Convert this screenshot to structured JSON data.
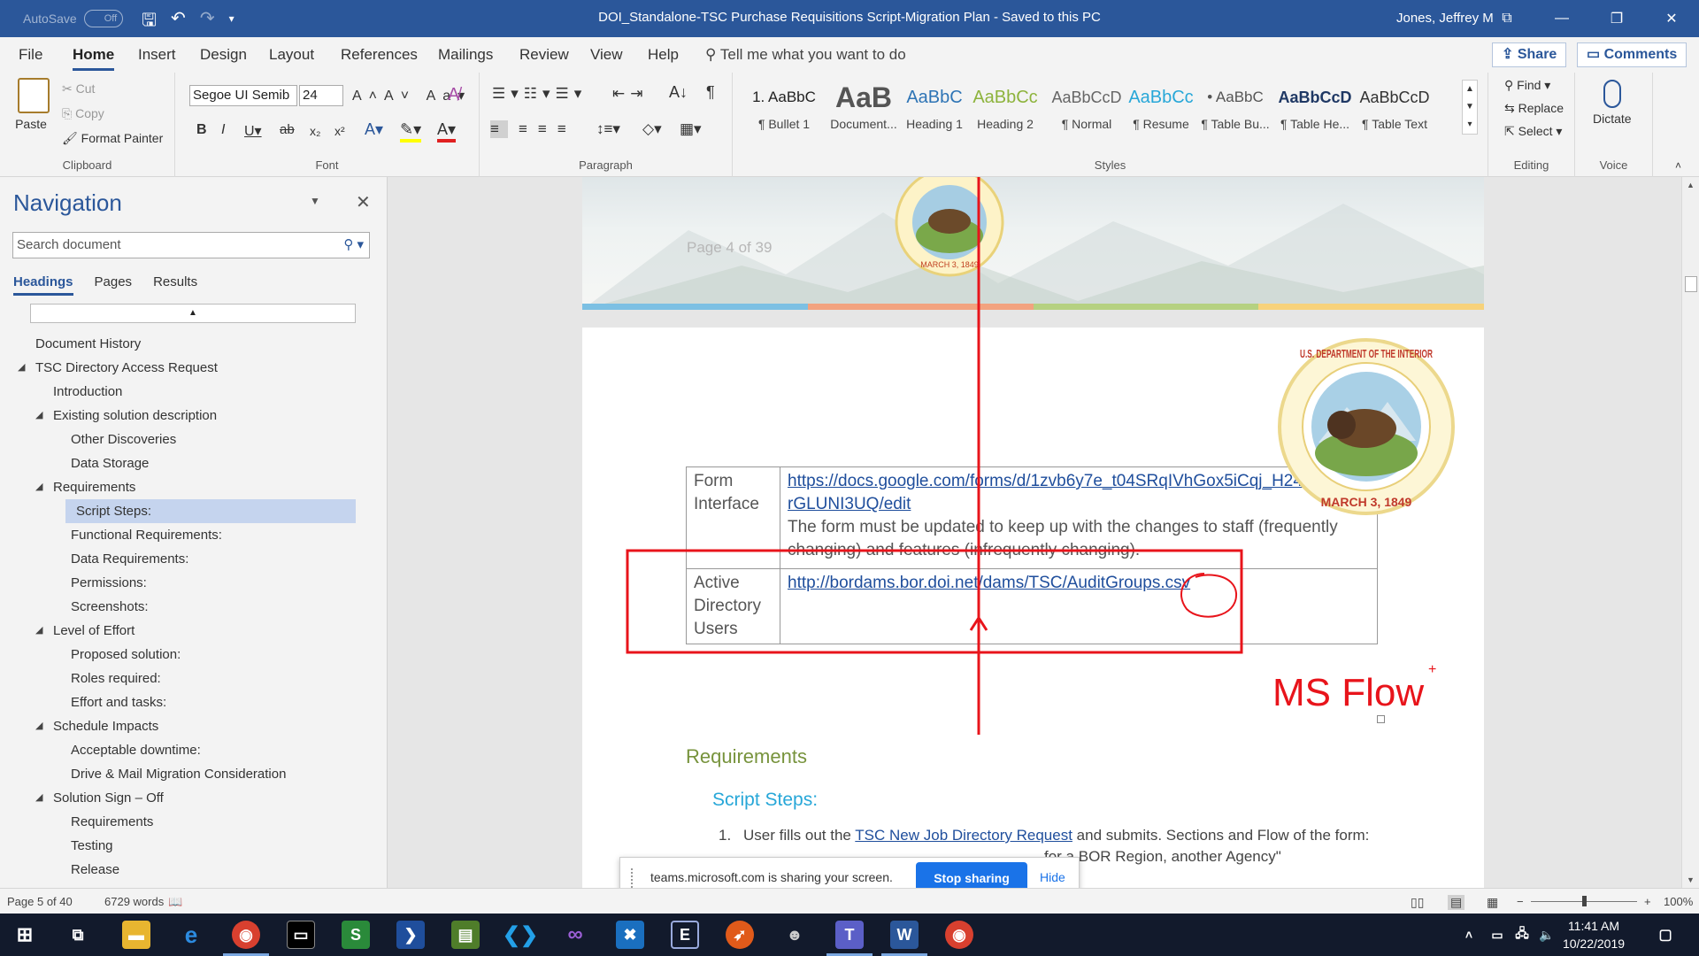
{
  "titlebar": {
    "autosave_label": "AutoSave",
    "autosave_state": "Off",
    "doc_title": "DOI_Standalone-TSC Purchase Requisitions Script-Migration Plan  -  Saved to this PC",
    "user": "Jones, Jeffrey M"
  },
  "tabs": [
    "File",
    "Home",
    "Insert",
    "Design",
    "Layout",
    "References",
    "Mailings",
    "Review",
    "View",
    "Help"
  ],
  "tell_me": "Tell me what you want to do",
  "share_label": "Share",
  "comments_label": "Comments",
  "ribbon": {
    "clipboard": {
      "label": "Clipboard",
      "paste": "Paste",
      "cut": "Cut",
      "copy": "Copy",
      "format_painter": "Format Painter"
    },
    "font": {
      "label": "Font",
      "font_name": "Segoe UI Semib",
      "font_size": "24"
    },
    "paragraph": {
      "label": "Paragraph"
    },
    "styles": {
      "label": "Styles",
      "items": [
        {
          "sample": "1. AaBbC",
          "name": "¶ Bullet 1",
          "color": "#222222"
        },
        {
          "sample": "AaB",
          "name": "Document...",
          "color": "#555555"
        },
        {
          "sample": "AaBbC",
          "name": "Heading 1",
          "color": "#2e74b5"
        },
        {
          "sample": "AaBbCc",
          "name": "Heading 2",
          "color": "#8db33c"
        },
        {
          "sample": "AaBbCcD",
          "name": "¶ Normal",
          "color": "#666666"
        },
        {
          "sample": "AaBbCc",
          "name": "¶ Resume",
          "color": "#27a7d8"
        },
        {
          "sample": "• AaBbC",
          "name": "¶ Table Bu...",
          "color": "#555555"
        },
        {
          "sample": "AaBbCcD",
          "name": "¶ Table He...",
          "color": "#1f3864"
        },
        {
          "sample": "AaBbCcD",
          "name": "¶ Table Text",
          "color": "#333333"
        }
      ]
    },
    "editing": {
      "label": "Editing",
      "find": "Find",
      "replace": "Replace",
      "select": "Select"
    },
    "voice": {
      "label": "Voice",
      "dictate": "Dictate"
    }
  },
  "navigation": {
    "title": "Navigation",
    "search_placeholder": "Search document",
    "tabs": [
      "Headings",
      "Pages",
      "Results"
    ],
    "items": [
      {
        "text": "Document History",
        "level": 1,
        "expander": false
      },
      {
        "text": "TSC Directory Access Request",
        "level": 1,
        "expander": true
      },
      {
        "text": "Introduction",
        "level": 2,
        "expander": false
      },
      {
        "text": "Existing solution description",
        "level": 2,
        "expander": true
      },
      {
        "text": "Other Discoveries",
        "level": 3,
        "expander": false
      },
      {
        "text": "Data Storage",
        "level": 3,
        "expander": false
      },
      {
        "text": "Requirements",
        "level": 2,
        "expander": true
      },
      {
        "text": "Script Steps:",
        "level": 3,
        "expander": false,
        "selected": true
      },
      {
        "text": "Functional Requirements:",
        "level": 3,
        "expander": false
      },
      {
        "text": "Data Requirements:",
        "level": 3,
        "expander": false
      },
      {
        "text": "Permissions:",
        "level": 3,
        "expander": false
      },
      {
        "text": "Screenshots:",
        "level": 3,
        "expander": false
      },
      {
        "text": "Level of Effort",
        "level": 2,
        "expander": true
      },
      {
        "text": "Proposed solution:",
        "level": 3,
        "expander": false
      },
      {
        "text": "Roles required:",
        "level": 3,
        "expander": false
      },
      {
        "text": "Effort and tasks:",
        "level": 3,
        "expander": false
      },
      {
        "text": "Schedule Impacts",
        "level": 2,
        "expander": true
      },
      {
        "text": "Acceptable downtime:",
        "level": 3,
        "expander": false
      },
      {
        "text": "Drive & Mail Migration Consideration",
        "level": 3,
        "expander": false
      },
      {
        "text": "Solution Sign – Off",
        "level": 2,
        "expander": true
      },
      {
        "text": "Requirements",
        "level": 3,
        "expander": false
      },
      {
        "text": "Testing",
        "level": 3,
        "expander": false
      },
      {
        "text": "Release",
        "level": 3,
        "expander": false
      }
    ]
  },
  "document": {
    "page_header_text": "Page 4 of 39",
    "seal_top": "U.S. DEPARTMENT OF THE INTERIOR",
    "seal_bottom": "MARCH 3, 1849",
    "table": [
      {
        "label": "Form Interface",
        "link": "https://docs.google.com/forms/d/1zvb6y7e_t04SRqIVhGox5iCqj_H2461U9QrGLUNI3UQ/edit",
        "note": "The form must be updated to keep up with the changes to staff (frequently changing) and features (infrequently changing)."
      },
      {
        "label": "Active Directory Users",
        "link": "http://bordams.bor.doi.net/dams/TSC/AuditGroups.csv"
      }
    ],
    "annotation": "MS Flow",
    "heading_requirements": "Requirements",
    "heading_script_steps": "Script Steps:",
    "list_num": "1.",
    "list_prefix": "User fills out the ",
    "list_link": "TSC New Job Directory Request",
    "list_suffix": " and submits. Sections and Flow of the form:",
    "list_next_fragment": "for a BOR Region, another Agency\""
  },
  "share_banner": {
    "text": "teams.microsoft.com is sharing your screen.",
    "stop": "Stop sharing",
    "hide": "Hide"
  },
  "status": {
    "page": "Page 5 of 40",
    "words": "6729 words",
    "zoom": "100%"
  },
  "clock": {
    "time": "11:41 AM",
    "date": "10/22/2019"
  },
  "colors": {
    "accent": "#2b579a",
    "annotation_red": "#e8141b"
  }
}
